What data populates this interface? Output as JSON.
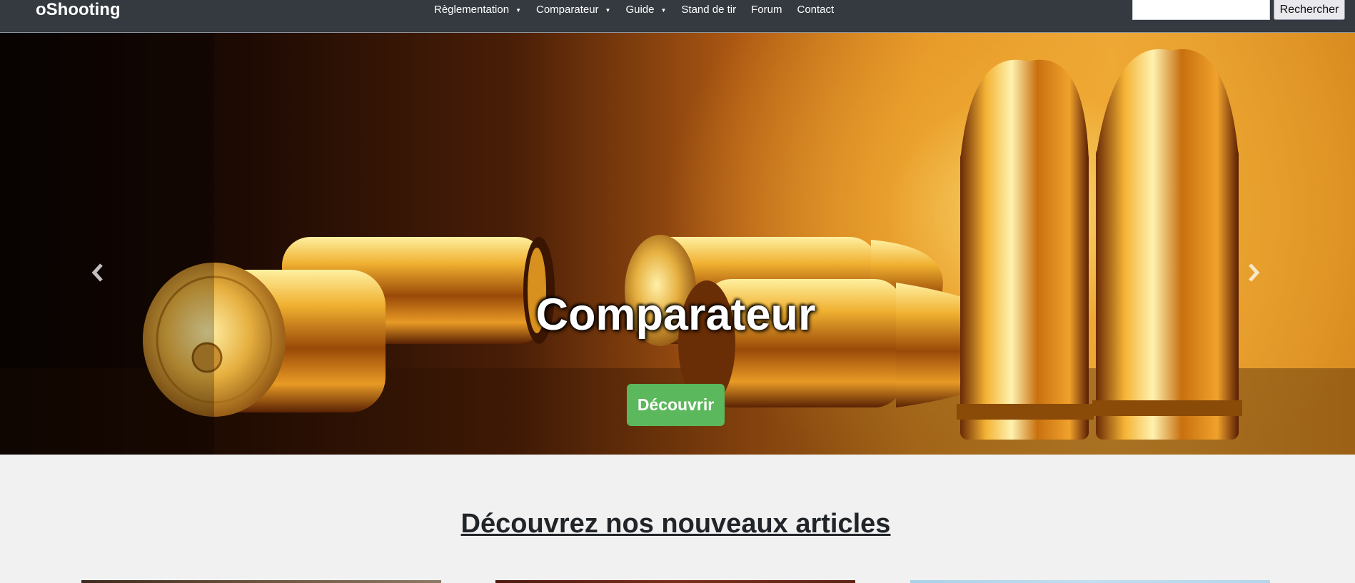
{
  "navbar": {
    "brand": "oShooting",
    "items": [
      {
        "label": "Règlementation",
        "dropdown": true
      },
      {
        "label": "Comparateur",
        "dropdown": true
      },
      {
        "label": "Guide",
        "dropdown": true
      },
      {
        "label": "Stand de tir",
        "dropdown": false
      },
      {
        "label": "Forum",
        "dropdown": false
      },
      {
        "label": "Contact",
        "dropdown": false
      }
    ],
    "caret_glyph": "▼",
    "search": {
      "placeholder": "",
      "value": "",
      "button_label": "Rechercher"
    }
  },
  "hero": {
    "title": "Comparateur",
    "button_label": "Découvrir",
    "prev_icon": "chevron-left-icon",
    "next_icon": "chevron-right-icon"
  },
  "section": {
    "title": "Découvrez nos nouveaux articles"
  },
  "colors": {
    "navbar_bg": "#343a40",
    "button_green": "#5cb85c",
    "page_bg": "#f1f1f1",
    "heading_text": "#212529"
  }
}
